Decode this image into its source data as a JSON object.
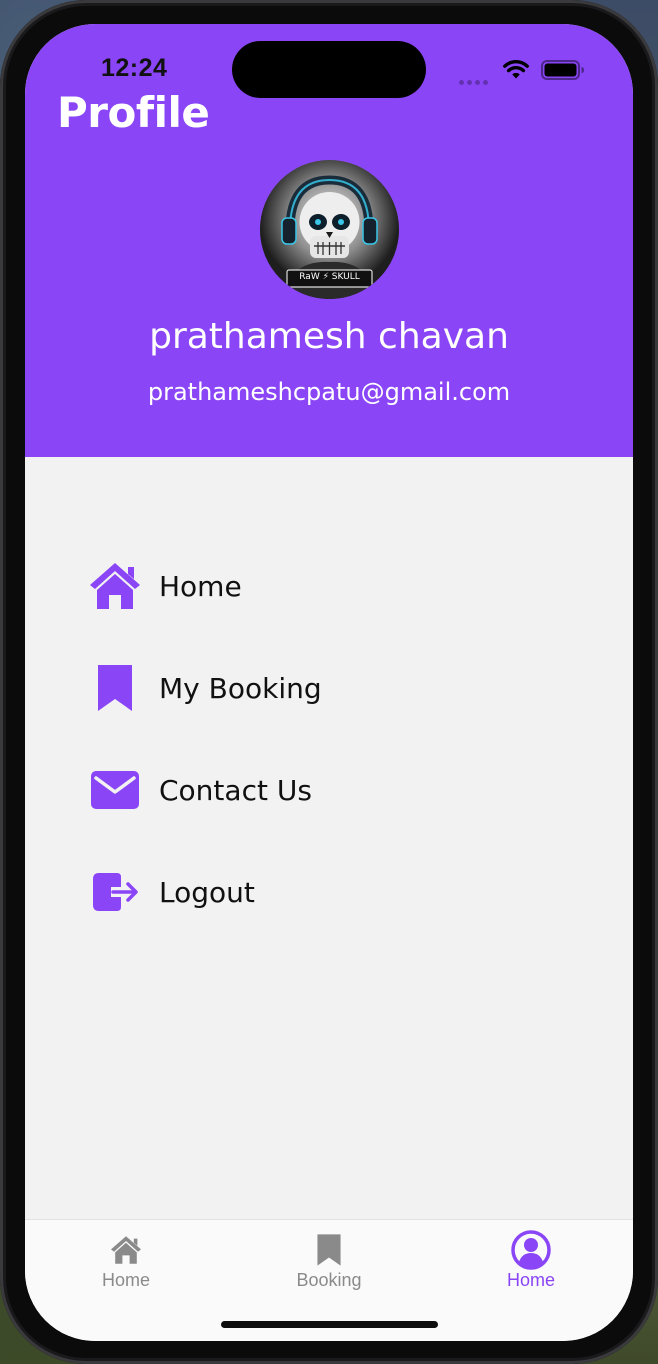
{
  "status_bar": {
    "time": "12:24",
    "icons": [
      "signal-dots-icon",
      "wifi-icon",
      "battery-icon"
    ]
  },
  "header": {
    "title": "Profile",
    "background_color": "#8a45f7"
  },
  "profile": {
    "avatar_icon": "skull-avatar",
    "avatar_caption": "RaW ⚡ SKULL",
    "name": "prathamesh chavan",
    "email": "prathameshcpatu@gmail.com"
  },
  "menu": {
    "items": [
      {
        "label": "Home",
        "icon": "home-icon"
      },
      {
        "label": "My Booking",
        "icon": "bookmark-icon"
      },
      {
        "label": "Contact Us",
        "icon": "envelope-icon"
      },
      {
        "label": "Logout",
        "icon": "logout-icon"
      }
    ],
    "icon_color": "#8a45f7"
  },
  "tab_bar": {
    "tabs": [
      {
        "label": "Home",
        "icon": "home-icon",
        "active": false
      },
      {
        "label": "Booking",
        "icon": "bookmark-icon",
        "active": false
      },
      {
        "label": "Home",
        "icon": "user-circle-icon",
        "active": true
      }
    ],
    "active_color": "#8a45f7",
    "inactive_color": "#8a8a8a"
  }
}
